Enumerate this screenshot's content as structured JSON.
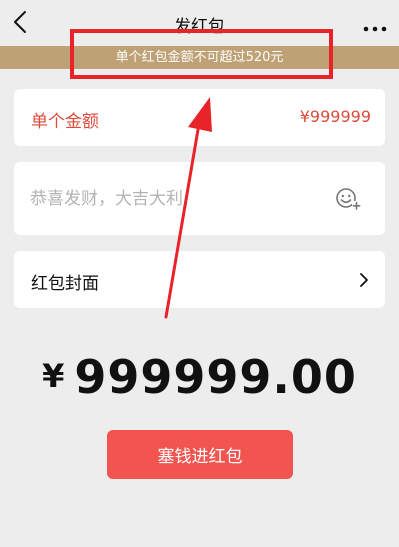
{
  "nav": {
    "title": "发红包",
    "back_icon": "chevron-left-icon",
    "more_icon": "more-dots-icon"
  },
  "notice": {
    "text": "单个红包金额不可超过520元"
  },
  "amount": {
    "label": "单个金额",
    "value": "¥999999"
  },
  "greeting": {
    "placeholder": "恭喜发财，大吉大利",
    "value": "",
    "emoji_icon": "emoji-add-icon"
  },
  "cover": {
    "label": "红包封面",
    "chevron_icon": "chevron-right-icon"
  },
  "total": {
    "currency": "¥",
    "value": "999999.00"
  },
  "submit": {
    "label": "塞钱进红包"
  },
  "colors": {
    "accent_red": "#e04b3b",
    "button_red": "#f25450",
    "notice_bg": "#bfa176",
    "annotation_red": "#e8232a",
    "page_bg": "#ededed"
  }
}
